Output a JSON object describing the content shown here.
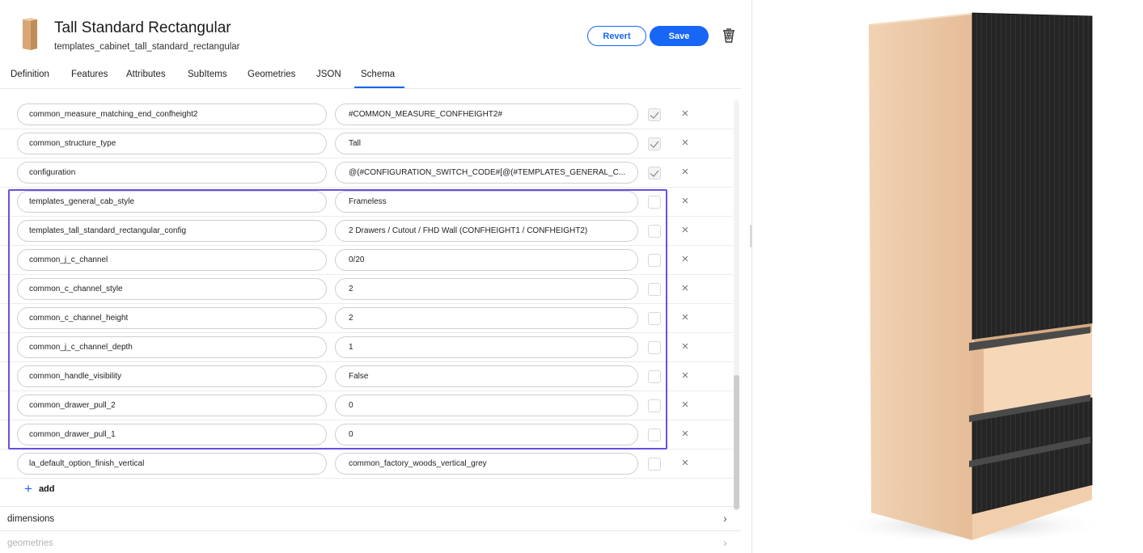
{
  "header": {
    "title": "Tall Standard Rectangular",
    "subtitle": "templates_cabinet_tall_standard_rectangular",
    "revert_label": "Revert",
    "save_label": "Save"
  },
  "tabs": [
    {
      "label": "Definition",
      "active": false
    },
    {
      "label": "Features",
      "active": false
    },
    {
      "label": "Attributes",
      "active": false
    },
    {
      "label": "SubItems",
      "active": false
    },
    {
      "label": "Geometries",
      "active": false
    },
    {
      "label": "JSON",
      "active": false
    },
    {
      "label": "Schema",
      "active": true
    }
  ],
  "rows": [
    {
      "key": "common_measure_matching_end_confheight2",
      "value": "#COMMON_MEASURE_CONFHEIGHT2#",
      "checked": true
    },
    {
      "key": "common_structure_type",
      "value": "Tall",
      "checked": true
    },
    {
      "key": "configuration",
      "value": "@(#CONFIGURATION_SWITCH_CODE#[@(#TEMPLATES_GENERAL_C...",
      "checked": true
    },
    {
      "key": "templates_general_cab_style",
      "value": "Frameless",
      "checked": false
    },
    {
      "key": "templates_tall_standard_rectangular_config",
      "value": "2 Drawers / Cutout / FHD Wall (CONFHEIGHT1 / CONFHEIGHT2)",
      "checked": false
    },
    {
      "key": "common_j_c_channel",
      "value": "0/20",
      "checked": false
    },
    {
      "key": "common_c_channel_style",
      "value": "2",
      "checked": false
    },
    {
      "key": "common_c_channel_height",
      "value": "2",
      "checked": false
    },
    {
      "key": "common_j_c_channel_depth",
      "value": "1",
      "checked": false
    },
    {
      "key": "common_handle_visibility",
      "value": "False",
      "checked": false
    },
    {
      "key": "common_drawer_pull_2",
      "value": "0",
      "checked": false
    },
    {
      "key": "common_drawer_pull_1",
      "value": "0",
      "checked": false
    },
    {
      "key": "la_default_option_finish_vertical",
      "value": "common_factory_woods_vertical_grey",
      "checked": false
    }
  ],
  "delete_glyph": "×",
  "add_label": "add",
  "add_glyph": "+",
  "sections": [
    {
      "label": "dimensions",
      "chevron": "›",
      "faded": false
    },
    {
      "label": "geometries",
      "chevron": "›",
      "faded": true
    }
  ],
  "colors": {
    "accent": "#1766f6",
    "highlight": "#6a4fe0",
    "wood": "#ecc6a3",
    "door": "#2b2b2b"
  },
  "icons": {
    "thumbnail": "cabinet-thumbnail-icon",
    "delete": "trash-basket-icon",
    "add": "plus-icon",
    "row_remove": "close-icon",
    "chevron": "chevron-right-icon"
  }
}
